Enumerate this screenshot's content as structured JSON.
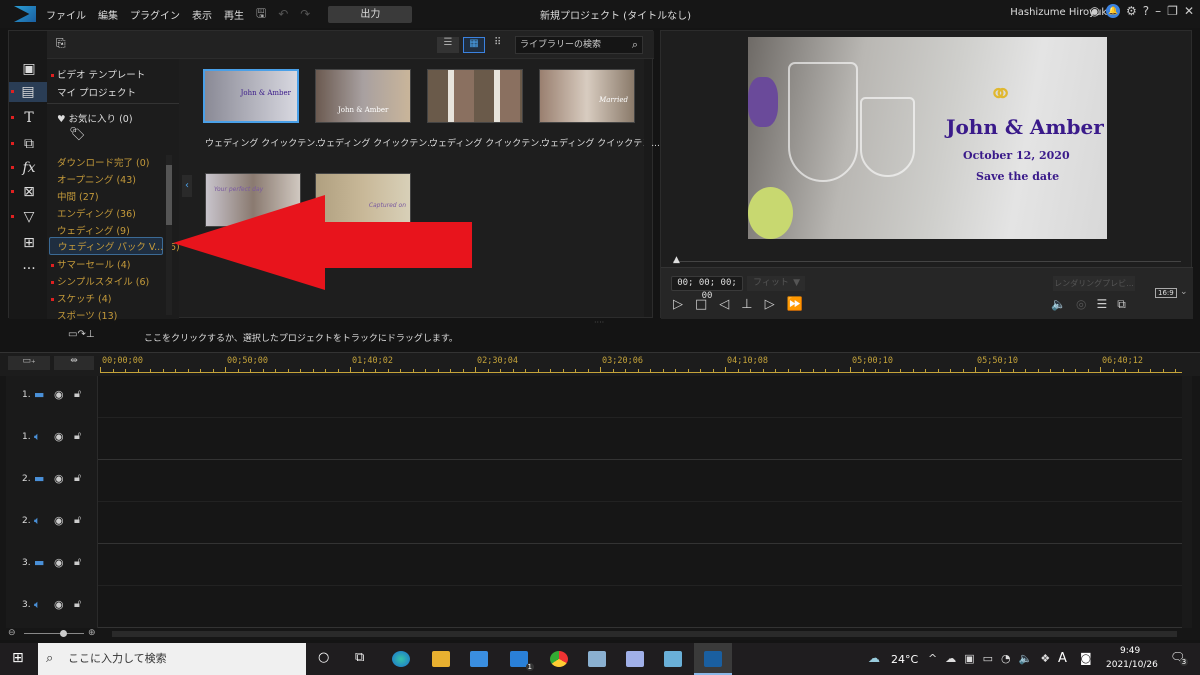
{
  "menubar": {
    "items": [
      "ファイル",
      "編集",
      "プラグイン",
      "表示",
      "再生"
    ],
    "output_label": "出力",
    "title": "新規プロジェクト (タイトルなし)",
    "user": "Hashizume Hiroyuki"
  },
  "library": {
    "search_placeholder": "ライブラリーの検索",
    "top_items": [
      "ビデオ テンプレート",
      "マイ プロジェクト"
    ],
    "favorites": "お気に入り (0)",
    "categories": [
      "ダウンロード完了 (0)",
      "オープニング (43)",
      "中間 (27)",
      "エンディング (36)",
      "ウェディング (9)",
      "ウェディング パック V... (6)",
      "サマーセール (4)",
      "シンプルスタイル (6)",
      "スケッチ (4)",
      "スポーツ (13)"
    ],
    "thumbnails": [
      {
        "label": "ウェディング クイックテン...",
        "text": "John & Amber"
      },
      {
        "label": "ウェディング クイックテン...",
        "text": "John & Amber"
      },
      {
        "label": "ウェディング クイックテン...",
        "text": ""
      },
      {
        "label": "ウェディング クイックテン...",
        "text": "Married"
      },
      {
        "label": "",
        "text": "Your perfect day"
      },
      {
        "label": "",
        "text": "Captured on"
      }
    ]
  },
  "preview": {
    "title": "John & Amber",
    "date": "October 12, 2020",
    "subtitle": "Save the date",
    "timecode": "00; 00; 00; 00",
    "fit": "フィット",
    "render_label": "レンダリングプレビ...",
    "aspect": "16:9",
    "accent": "#3a1a8a"
  },
  "timeline": {
    "hint": "ここをクリックするか、選択したプロジェクトをトラックにドラッグします。",
    "ruler": [
      "00;00;00",
      "00;50;00",
      "01;40;02",
      "02;30;04",
      "03;20;06",
      "04;10;08",
      "05;00;10",
      "05;50;10",
      "06;40;12"
    ],
    "tracks": [
      {
        "num": "1.",
        "type": "video"
      },
      {
        "num": "1.",
        "type": "audio"
      },
      {
        "num": "2.",
        "type": "video"
      },
      {
        "num": "2.",
        "type": "audio"
      },
      {
        "num": "3.",
        "type": "video"
      },
      {
        "num": "3.",
        "type": "audio"
      }
    ]
  },
  "taskbar": {
    "search_placeholder": "ここに入力して検索",
    "weather": "24°C",
    "time": "9:49",
    "date": "2021/10/26",
    "notifications": "3",
    "mail_badge": "1",
    "ime": "A"
  },
  "annotation": {
    "arrow_color": "#e8141c"
  }
}
